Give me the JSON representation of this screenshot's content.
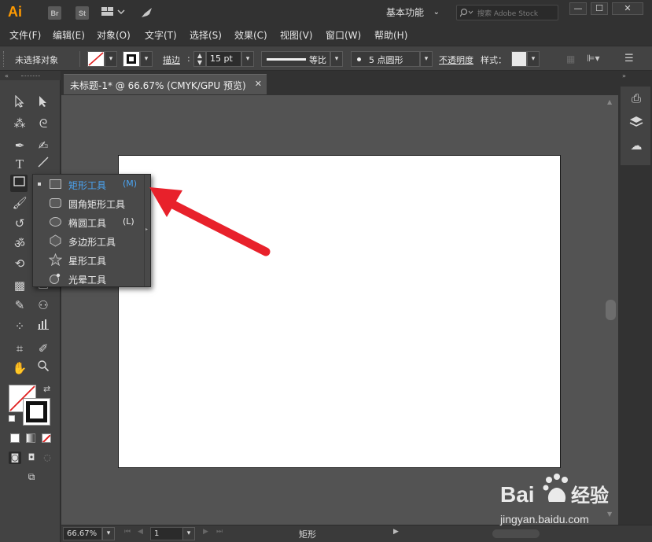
{
  "app": {
    "logo": "Ai",
    "badges": [
      "Br",
      "St"
    ],
    "workspace": "基本功能",
    "stock_search_placeholder": "搜索 Adobe Stock",
    "window_buttons": [
      "—",
      "☐",
      "✕"
    ]
  },
  "menu": [
    "文件(F)",
    "编辑(E)",
    "对象(O)",
    "文字(T)",
    "选择(S)",
    "效果(C)",
    "视图(V)",
    "窗口(W)",
    "帮助(H)"
  ],
  "control": {
    "selection": "未选择对象",
    "stroke_label": "描边",
    "stroke_value": "15 pt",
    "profile": "等比",
    "brush": "5 点圆形",
    "opacity_label": "不透明度",
    "style_label": "样式："
  },
  "document": {
    "tab_title": "未标题-1* @ 66.67% (CMYK/GPU 预览)",
    "zoom": "66.67%",
    "artboard": "1",
    "current_tool": "矩形"
  },
  "flyout": {
    "items": [
      {
        "icon": "rectangle-icon",
        "label": "矩形工具",
        "key": "(M)"
      },
      {
        "icon": "rounded-rectangle-icon",
        "label": "圆角矩形工具",
        "key": ""
      },
      {
        "icon": "ellipse-icon",
        "label": "椭圆工具",
        "key": "(L)"
      },
      {
        "icon": "polygon-icon",
        "label": "多边形工具",
        "key": ""
      },
      {
        "icon": "star-icon",
        "label": "星形工具",
        "key": ""
      },
      {
        "icon": "flare-icon",
        "label": "光晕工具",
        "key": ""
      }
    ]
  },
  "watermark": {
    "text": "jingyan.baidu.com",
    "logo_text": "Baidu经验"
  },
  "colors": {
    "app_bg": "#323232",
    "panel_bg": "#434343",
    "canvas_bg": "#535353",
    "artboard": "#ffffff",
    "selected_text": "#4aa3f0",
    "annotation_arrow": "#e8212b",
    "logo": "#ff9a00"
  }
}
